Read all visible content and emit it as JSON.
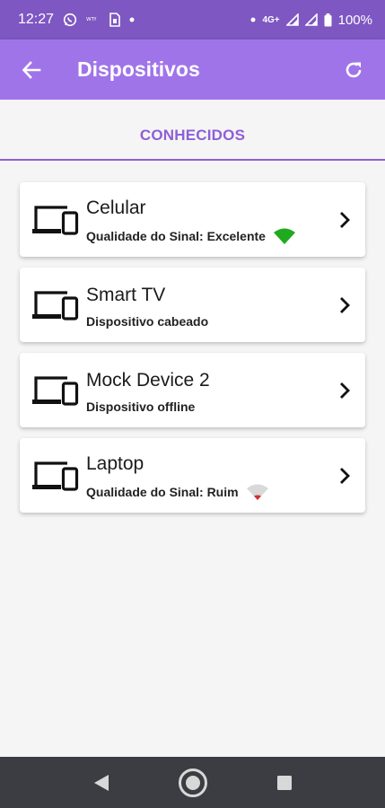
{
  "status_bar": {
    "time": "12:27",
    "network": "4G+",
    "battery": "100%"
  },
  "app_bar": {
    "title": "Dispositivos"
  },
  "tabs": [
    {
      "label": "CONHECIDOS"
    }
  ],
  "devices": [
    {
      "name": "Celular",
      "status": "Qualidade do Sinal: Excelente",
      "signal": "excellent",
      "signal_color": "#1faa1f"
    },
    {
      "name": "Smart TV",
      "status": "Dispositivo cabeado",
      "signal": null
    },
    {
      "name": "Mock Device 2",
      "status": "Dispositivo offline",
      "signal": null
    },
    {
      "name": "Laptop",
      "status": "Qualidade do Sinal: Ruim",
      "signal": "poor",
      "signal_color": "#d32f2f"
    }
  ],
  "colors": {
    "status_bar": "#7e57c2",
    "app_bar": "#a074e9",
    "accent": "#8e5fd6",
    "nav_bar": "#3b3d42"
  }
}
